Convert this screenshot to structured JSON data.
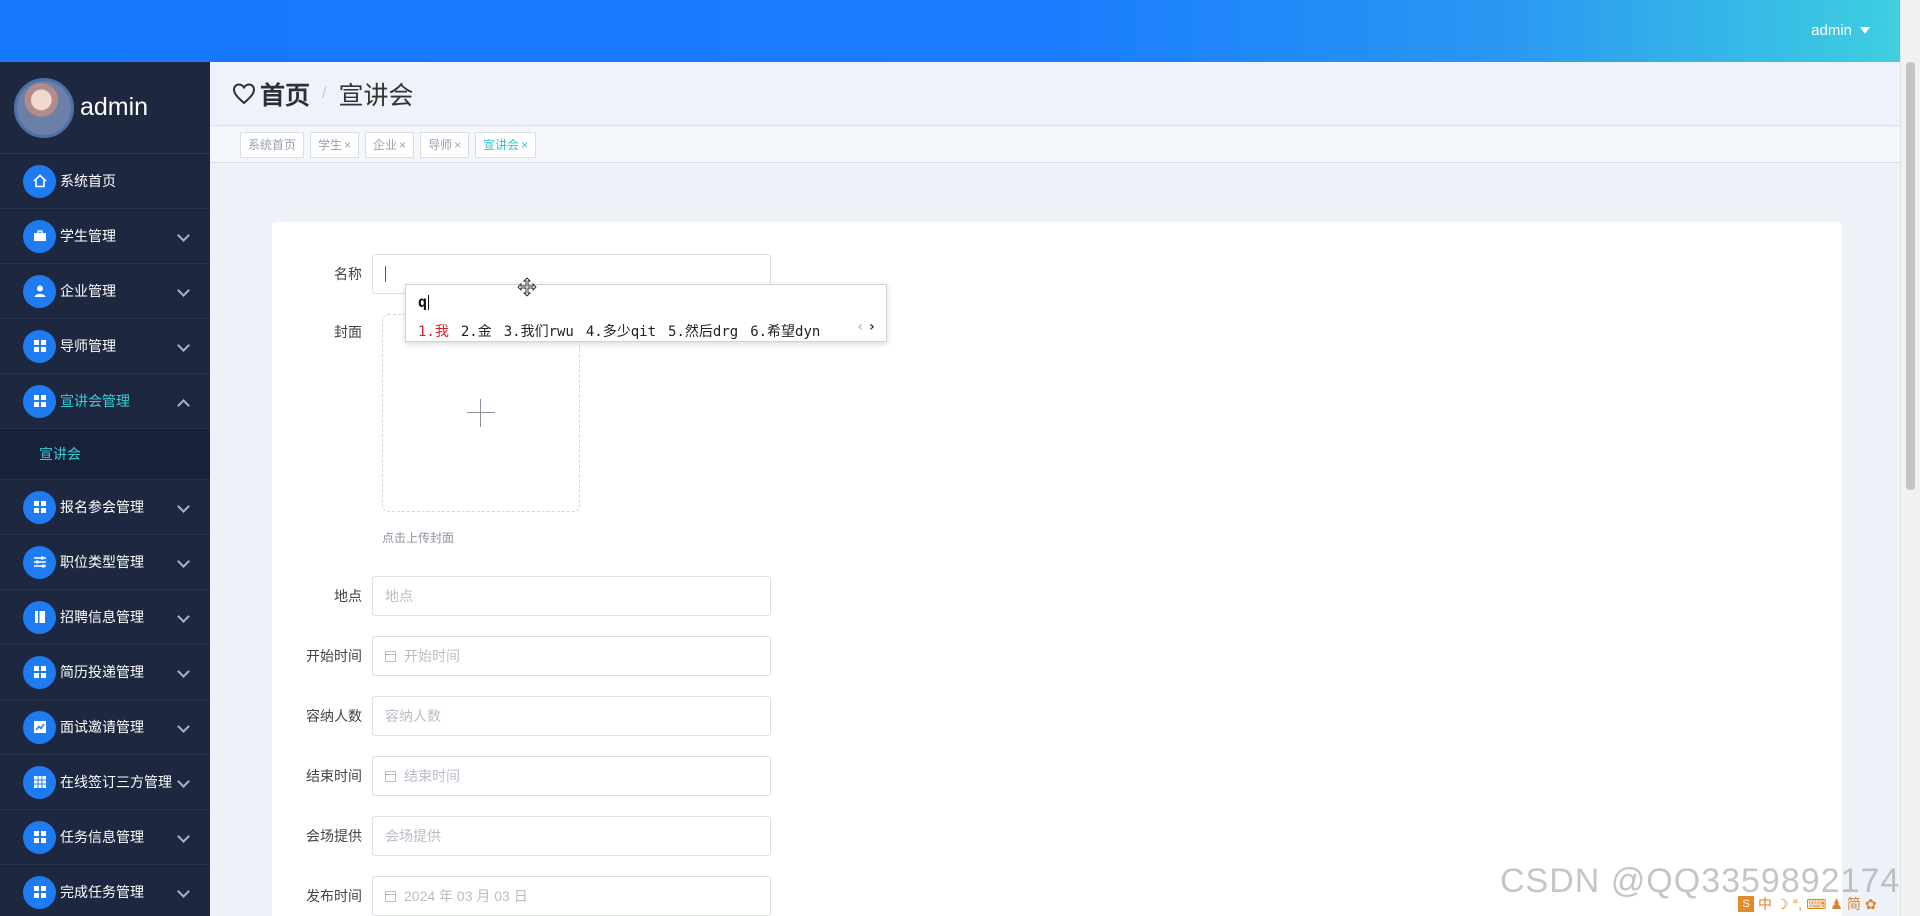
{
  "topbar": {
    "user": "admin"
  },
  "sidebar": {
    "username": "admin",
    "items": [
      {
        "label": "系统首页",
        "icon": "home-icon",
        "chevron": "none"
      },
      {
        "label": "学生管理",
        "icon": "briefcase-icon",
        "chevron": "down"
      },
      {
        "label": "企业管理",
        "icon": "user-icon",
        "chevron": "down"
      },
      {
        "label": "导师管理",
        "icon": "grid-icon",
        "chevron": "down"
      },
      {
        "label": "宣讲会管理",
        "icon": "grid-icon",
        "chevron": "up",
        "active": true,
        "children": [
          "宣讲会"
        ]
      },
      {
        "label": "报名参会管理",
        "icon": "grid-icon",
        "chevron": "down"
      },
      {
        "label": "职位类型管理",
        "icon": "sliders-icon",
        "chevron": "down"
      },
      {
        "label": "招聘信息管理",
        "icon": "book-icon",
        "chevron": "down"
      },
      {
        "label": "简历投递管理",
        "icon": "grid-icon",
        "chevron": "down"
      },
      {
        "label": "面试邀请管理",
        "icon": "chart-icon",
        "chevron": "down"
      },
      {
        "label": "在线签订三方管理",
        "icon": "table-icon",
        "chevron": "down"
      },
      {
        "label": "任务信息管理",
        "icon": "grid-icon",
        "chevron": "down"
      },
      {
        "label": "完成任务管理",
        "icon": "grid-icon",
        "chevron": "down"
      }
    ]
  },
  "breadcrumb": {
    "home": "首页",
    "separator": "/",
    "current": "宣讲会"
  },
  "tags": [
    {
      "label": "系统首页",
      "closable": false
    },
    {
      "label": "学生",
      "closable": true
    },
    {
      "label": "企业",
      "closable": true
    },
    {
      "label": "导师",
      "closable": true
    },
    {
      "label": "宣讲会",
      "closable": true,
      "active": true
    }
  ],
  "tag_close": "×",
  "form": {
    "name_label": "名称",
    "cover_label": "封面",
    "cover_hint": "点击上传封面",
    "location_label": "地点",
    "location_placeholder": "地点",
    "start_label": "开始时间",
    "start_placeholder": "开始时间",
    "capacity_label": "容纳人数",
    "capacity_placeholder": "容纳人数",
    "end_label": "结束时间",
    "end_placeholder": "结束时间",
    "venue_label": "会场提供",
    "venue_placeholder": "会场提供",
    "publish_label": "发布时间",
    "publish_value": "2024 年 03 月 03 日"
  },
  "ime": {
    "typed": "q",
    "candidates": [
      "1.我",
      "2.金",
      "3.我们rwu",
      "4.多少qit",
      "5.然后drg",
      "6.希望dyn"
    ],
    "prev": "‹",
    "next": "›"
  },
  "watermark": "CSDN @QQ3359892174",
  "tray": {
    "items": [
      "S",
      "中",
      "☽",
      "°,",
      "⌨",
      "♟",
      "简",
      "✿"
    ]
  },
  "colors": {
    "accent": "#1677ff",
    "active_menu": "#33d1d7",
    "sidebar_bg": "#1d2740",
    "ime_highlight": "#d9212c"
  }
}
